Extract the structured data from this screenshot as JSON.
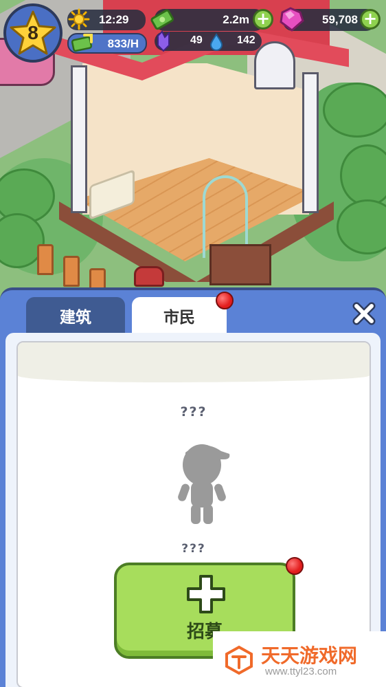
{
  "hud": {
    "level": "8",
    "time": "12:29",
    "cash": "2.2m",
    "gems": "59,708",
    "income_rate": "833/H",
    "energy": "49",
    "water": "142",
    "icons": {
      "time": "sun-icon",
      "cash": "cash-icon",
      "gems": "gem-icon",
      "income": "income-icon",
      "energy": "crystal-icon",
      "water": "water-drop-icon"
    }
  },
  "panel": {
    "tabs": [
      {
        "label": "建筑",
        "active": false
      },
      {
        "label": "市民",
        "active": true,
        "has_notification": true
      }
    ],
    "close_icon": "close-icon",
    "citizen_name": "???",
    "citizen_label": "???",
    "recruit_label": "招募",
    "recruit_has_notification": true
  },
  "colors": {
    "panel_blue": "#5b82d6",
    "tab_inactive": "#3f5b92",
    "recruit_green": "#a7dd5c",
    "notification_red": "#e21d1d",
    "roof_red": "#e24b5b"
  },
  "watermark": {
    "title": "天天游戏网",
    "url": "www.ttyl23.com"
  }
}
